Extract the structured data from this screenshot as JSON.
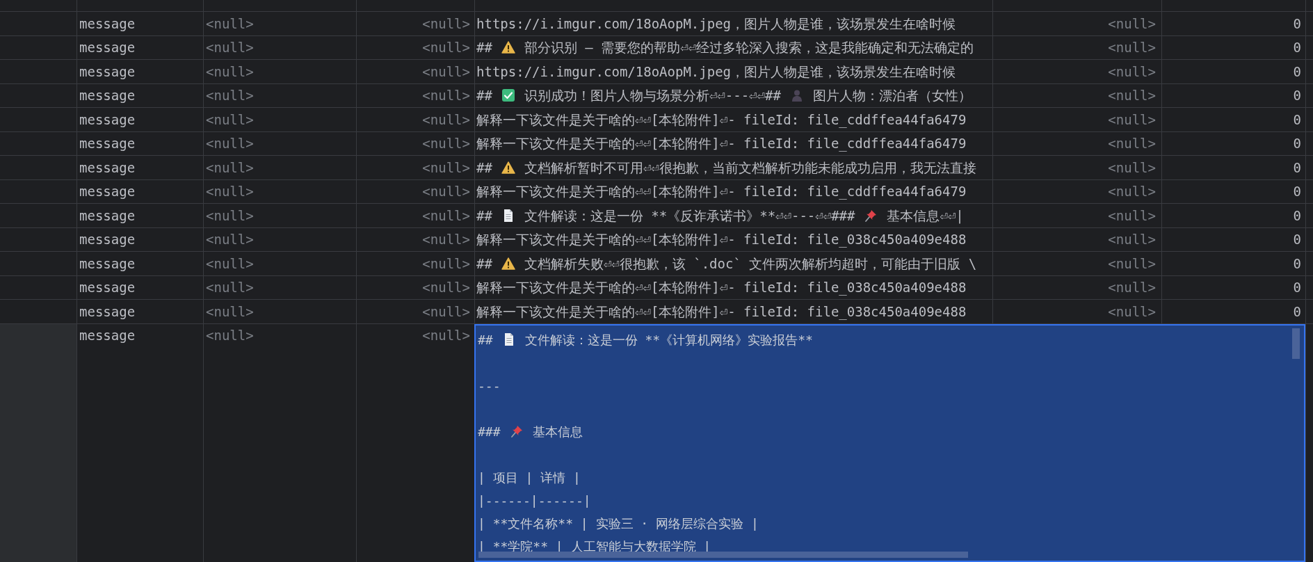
{
  "rows": [
    {
      "editing": false,
      "column_2": "message",
      "column_3": "<null>",
      "column_4": "<null>",
      "column_5": [
        {
          "kind": "text",
          "text": "https://i.imgur.com/18oAopM.jpeg，图片人物是谁，该场景发生在啥时候"
        }
      ],
      "column_6": "<null>",
      "column_7": "0"
    },
    {
      "editing": false,
      "column_2": "message",
      "column_3": "<null>",
      "column_4": "<null>",
      "column_5": [
        {
          "kind": "text",
          "text": "##"
        },
        {
          "kind": "warning"
        },
        {
          "kind": "text",
          "text": "部分识别 — 需要您的帮助⏎⏎经过多轮深入搜索，这是我能确定和无法确定的"
        }
      ],
      "column_6": "<null>",
      "column_7": "0"
    },
    {
      "editing": false,
      "column_2": "message",
      "column_3": "<null>",
      "column_4": "<null>",
      "column_5": [
        {
          "kind": "text",
          "text": "https://i.imgur.com/18oAopM.jpeg，图片人物是谁，该场景发生在啥时候"
        }
      ],
      "column_6": "<null>",
      "column_7": "0"
    },
    {
      "editing": false,
      "column_2": "message",
      "column_3": "<null>",
      "column_4": "<null>",
      "column_5": [
        {
          "kind": "text",
          "text": "##"
        },
        {
          "kind": "check"
        },
        {
          "kind": "text",
          "text": "识别成功！图片人物与场景分析⏎⏎---⏎⏎##"
        },
        {
          "kind": "person"
        },
        {
          "kind": "text",
          "text": "图片人物：漂泊者（女性）"
        }
      ],
      "column_6": "<null>",
      "column_7": "0"
    },
    {
      "editing": false,
      "column_2": "message",
      "column_3": "<null>",
      "column_4": "<null>",
      "column_5": [
        {
          "kind": "text",
          "text": "解释一下该文件是关于啥的⏎⏎[本轮附件]⏎- fileId: file_cddffea44fa6479"
        }
      ],
      "column_6": "<null>",
      "column_7": "0"
    },
    {
      "editing": false,
      "column_2": "message",
      "column_3": "<null>",
      "column_4": "<null>",
      "column_5": [
        {
          "kind": "text",
          "text": "解释一下该文件是关于啥的⏎⏎[本轮附件]⏎- fileId: file_cddffea44fa6479"
        }
      ],
      "column_6": "<null>",
      "column_7": "0"
    },
    {
      "editing": false,
      "column_2": "message",
      "column_3": "<null>",
      "column_4": "<null>",
      "column_5": [
        {
          "kind": "text",
          "text": "##"
        },
        {
          "kind": "warning"
        },
        {
          "kind": "text",
          "text": "文档解析暂时不可用⏎⏎很抱歉，当前文档解析功能未能成功启用，我无法直接"
        }
      ],
      "column_6": "<null>",
      "column_7": "0"
    },
    {
      "editing": false,
      "column_2": "message",
      "column_3": "<null>",
      "column_4": "<null>",
      "column_5": [
        {
          "kind": "text",
          "text": "解释一下该文件是关于啥的⏎⏎[本轮附件]⏎- fileId: file_cddffea44fa6479"
        }
      ],
      "column_6": "<null>",
      "column_7": "0"
    },
    {
      "editing": false,
      "column_2": "message",
      "column_3": "<null>",
      "column_4": "<null>",
      "column_5": [
        {
          "kind": "text",
          "text": "##"
        },
        {
          "kind": "document"
        },
        {
          "kind": "text",
          "text": "文件解读：这是一份 **《反诈承诺书》**⏎⏎---⏎⏎###"
        },
        {
          "kind": "pin"
        },
        {
          "kind": "text",
          "text": "基本信息⏎⏎|"
        }
      ],
      "column_6": "<null>",
      "column_7": "0"
    },
    {
      "editing": false,
      "column_2": "message",
      "column_3": "<null>",
      "column_4": "<null>",
      "column_5": [
        {
          "kind": "text",
          "text": "解释一下该文件是关于啥的⏎⏎[本轮附件]⏎- fileId: file_038c450a409e488"
        }
      ],
      "column_6": "<null>",
      "column_7": "0"
    },
    {
      "editing": false,
      "column_2": "message",
      "column_3": "<null>",
      "column_4": "<null>",
      "column_5": [
        {
          "kind": "text",
          "text": "##"
        },
        {
          "kind": "warning"
        },
        {
          "kind": "text",
          "text": "文档解析失败⏎⏎很抱歉，该 `.doc` 文件两次解析均超时，可能由于旧版 \\"
        }
      ],
      "column_6": "<null>",
      "column_7": "0"
    },
    {
      "editing": false,
      "column_2": "message",
      "column_3": "<null>",
      "column_4": "<null>",
      "column_5": [
        {
          "kind": "text",
          "text": "解释一下该文件是关于啥的⏎⏎[本轮附件]⏎- fileId: file_038c450a409e488"
        }
      ],
      "column_6": "<null>",
      "column_7": "0"
    },
    {
      "editing": false,
      "column_2": "message",
      "column_3": "<null>",
      "column_4": "<null>",
      "column_5": [
        {
          "kind": "text",
          "text": "解释一下该文件是关于啥的⏎⏎[本轮附件]⏎- fileId: file_038c450a409e488"
        }
      ],
      "column_6": "<null>",
      "column_7": "0"
    },
    {
      "editing": true,
      "column_2": "message",
      "column_3": "<null>",
      "column_4": "<null>",
      "editor_lines": [
        {
          "blank_before": false,
          "parts": [
            {
              "kind": "text",
              "text": "##"
            },
            {
              "kind": "document"
            },
            {
              "kind": "text",
              "text": "文件解读：这是一份 **《计算机网络》实验报告**"
            }
          ]
        },
        {
          "blank_before": true,
          "parts": [
            {
              "kind": "text",
              "text": "---"
            }
          ]
        },
        {
          "blank_before": true,
          "parts": [
            {
              "kind": "text",
              "text": "###"
            },
            {
              "kind": "pin"
            },
            {
              "kind": "text",
              "text": "基本信息"
            }
          ]
        },
        {
          "blank_before": true,
          "parts": [
            {
              "kind": "text",
              "text": "| 项目 | 详情 |"
            }
          ]
        },
        {
          "blank_before": false,
          "parts": [
            {
              "kind": "text",
              "text": "|------|------|"
            }
          ]
        },
        {
          "blank_before": false,
          "parts": [
            {
              "kind": "text",
              "text": "| **文件名称** | 实验三 · 网络层综合实验 |"
            }
          ]
        },
        {
          "blank_before": false,
          "parts": [
            {
              "kind": "text",
              "text": "| **学院** | 人工智能与大数据学院 |"
            }
          ]
        }
      ]
    }
  ]
}
